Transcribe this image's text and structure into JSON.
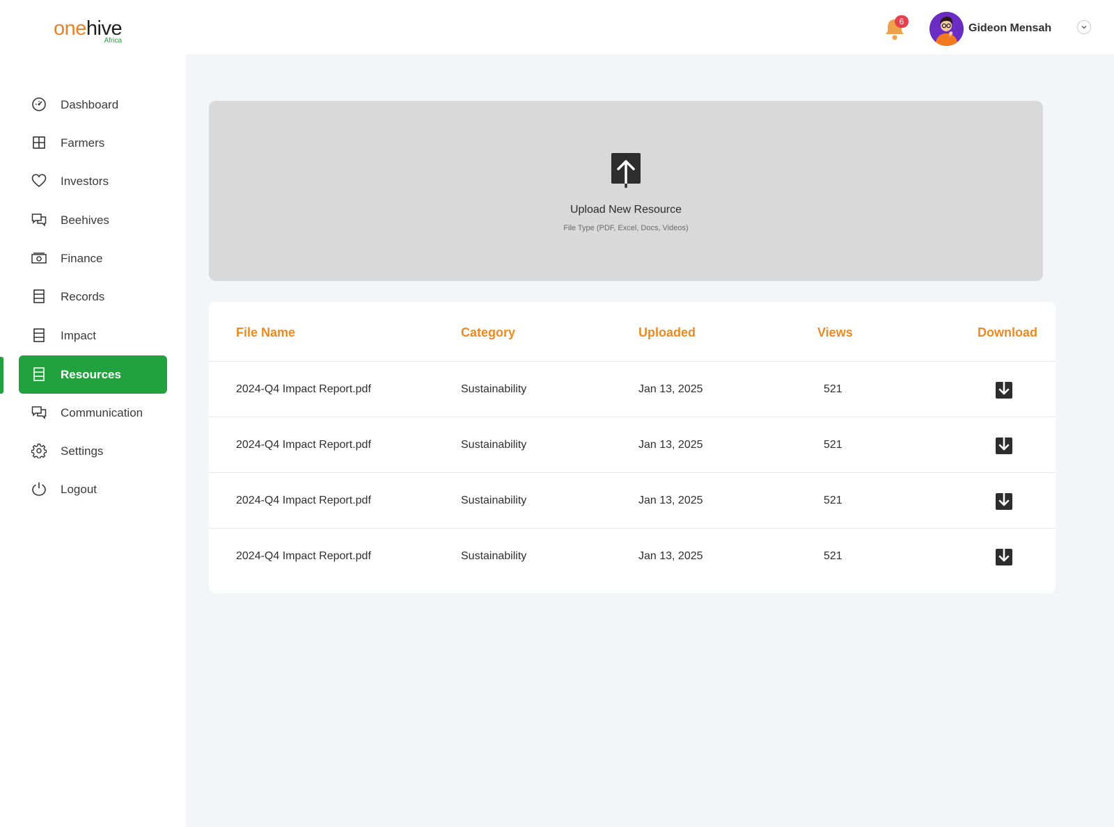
{
  "brand": {
    "name_part1": "one",
    "name_part2": "hive",
    "sub": "Africa",
    "accent": "#e8822a",
    "green": "#22a23e"
  },
  "header": {
    "notification_count": "6",
    "user_name": "Gideon Mensah"
  },
  "sidebar": {
    "items": [
      {
        "label": "Dashboard",
        "icon": "dashboard-icon"
      },
      {
        "label": "Farmers",
        "icon": "grid-icon"
      },
      {
        "label": "Investors",
        "icon": "heart-icon"
      },
      {
        "label": "Beehives",
        "icon": "chat-icon"
      },
      {
        "label": "Finance",
        "icon": "money-icon"
      },
      {
        "label": "Records",
        "icon": "document-icon"
      },
      {
        "label": "Impact",
        "icon": "document-icon"
      },
      {
        "label": "Resources",
        "icon": "document-icon",
        "active": true
      },
      {
        "label": "Communication",
        "icon": "chat-icon"
      },
      {
        "label": "Settings",
        "icon": "gear-icon"
      },
      {
        "label": "Logout",
        "icon": "power-icon"
      }
    ]
  },
  "upload": {
    "title": "Upload New Resource",
    "subtitle": "File Type (PDF, Excel, Docs, Videos)"
  },
  "table": {
    "columns": [
      "File Name",
      "Category",
      "Uploaded",
      "Views",
      "Download"
    ],
    "rows": [
      {
        "file": "2024-Q4 Impact Report.pdf",
        "category": "Sustainability",
        "uploaded": "Jan 13, 2025",
        "views": "521"
      },
      {
        "file": "2024-Q4 Impact Report.pdf",
        "category": "Sustainability",
        "uploaded": "Jan 13, 2025",
        "views": "521"
      },
      {
        "file": "2024-Q4 Impact Report.pdf",
        "category": "Sustainability",
        "uploaded": "Jan 13, 2025",
        "views": "521"
      },
      {
        "file": "2024-Q4 Impact Report.pdf",
        "category": "Sustainability",
        "uploaded": "Jan 13, 2025",
        "views": "521"
      }
    ]
  }
}
